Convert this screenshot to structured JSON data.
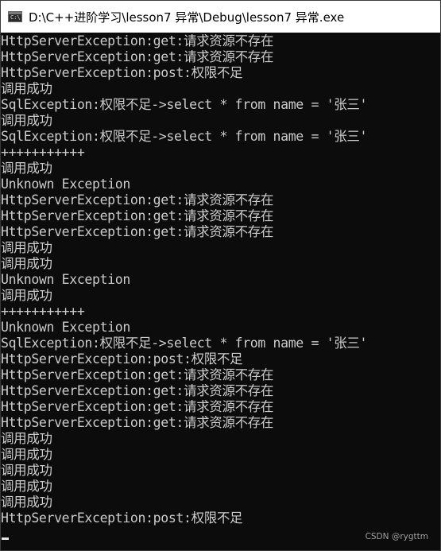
{
  "window": {
    "title": "D:\\C++进阶学习\\lesson7 异常\\Debug\\lesson7 异常.exe",
    "icon": "console-app-icon",
    "icon_glyph": "C:\\"
  },
  "console": {
    "lines": [
      "HttpServerException:get:请求资源不存在",
      "HttpServerException:get:请求资源不存在",
      "HttpServerException:post:权限不足",
      "调用成功",
      "SqlException:权限不足->select * from name = '张三'",
      "调用成功",
      "SqlException:权限不足->select * from name = '张三'",
      "+++++++++++",
      "调用成功",
      "Unknown Exception",
      "HttpServerException:get:请求资源不存在",
      "HttpServerException:get:请求资源不存在",
      "HttpServerException:get:请求资源不存在",
      "调用成功",
      "调用成功",
      "Unknown Exception",
      "调用成功",
      "+++++++++++",
      "Unknown Exception",
      "SqlException:权限不足->select * from name = '张三'",
      "HttpServerException:post:权限不足",
      "HttpServerException:get:请求资源不存在",
      "HttpServerException:get:请求资源不存在",
      "HttpServerException:get:请求资源不存在",
      "HttpServerException:get:请求资源不存在",
      "调用成功",
      "调用成功",
      "调用成功",
      "调用成功",
      "调用成功",
      "HttpServerException:post:权限不足"
    ]
  },
  "watermark": "CSDN @rygttm",
  "colors": {
    "console_background": "#0c0c0c",
    "console_text": "#cccccc",
    "titlebar_background": "#ffffff"
  }
}
